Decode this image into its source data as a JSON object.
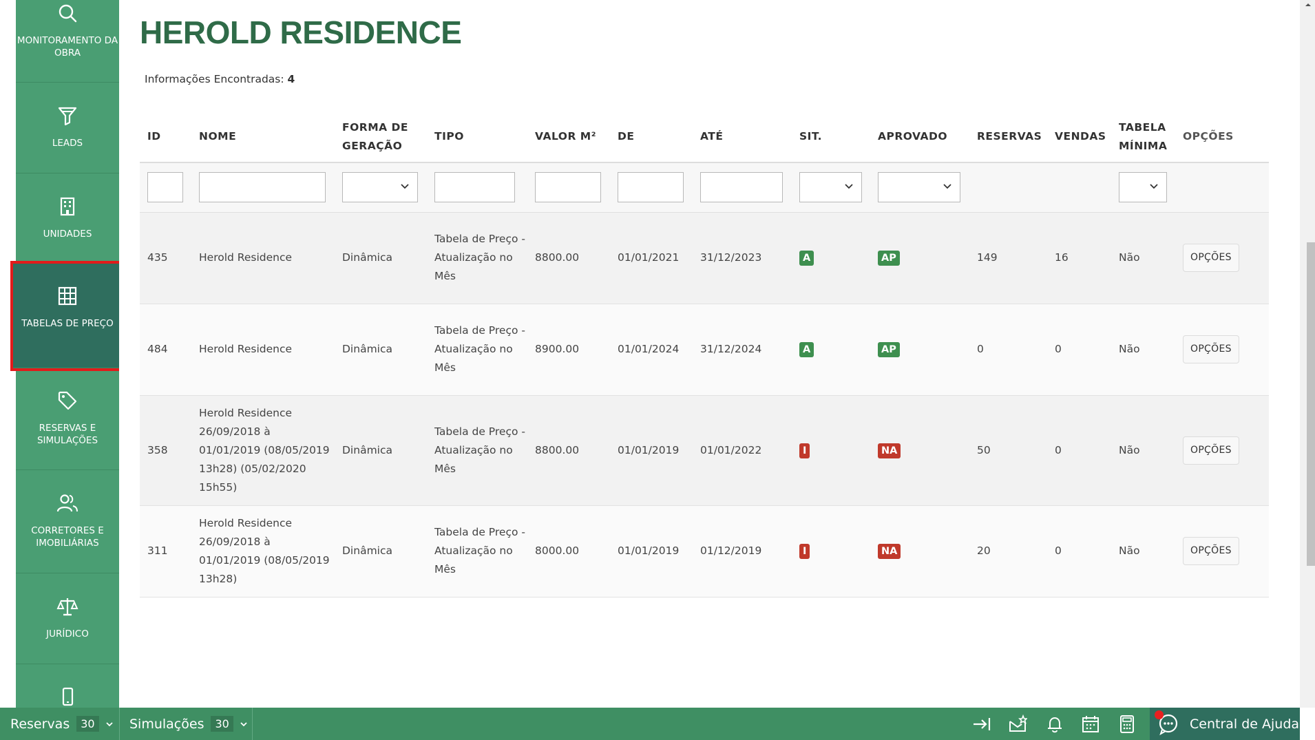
{
  "sidebar": {
    "items": [
      {
        "label": "MONITORAMENTO DA OBRA",
        "icon": "search-icon"
      },
      {
        "label": "LEADS",
        "icon": "filter-icon"
      },
      {
        "label": "UNIDADES",
        "icon": "building-icon"
      },
      {
        "label": "TABELAS DE PREÇO",
        "icon": "grid-table-icon",
        "active": true
      },
      {
        "label": "RESERVAS E SIMULAÇÕES",
        "icon": "tag-icon"
      },
      {
        "label": "CORRETORES E IMOBILIÁRIAS",
        "icon": "users-icon"
      },
      {
        "label": "JURÍDICO",
        "icon": "scales-icon"
      },
      {
        "label": "",
        "icon": "mobile-icon"
      }
    ]
  },
  "main": {
    "title": "HEROLD RESIDENCE",
    "info_label": "Informações Encontradas:",
    "info_count": "4"
  },
  "table": {
    "headers": [
      "ID",
      "NOME",
      "FORMA DE GERAÇÃO",
      "TIPO",
      "VALOR M²",
      "DE",
      "ATÉ",
      "SIT.",
      "APROVADO",
      "RESERVAS",
      "VENDAS",
      "TABELA MÍNIMA",
      "OPÇÕES"
    ],
    "rows": [
      {
        "id": "435",
        "nome": "Herold Residence",
        "forma": "Dinâmica",
        "tipo": "Tabela de Preço - Atualização no Mês",
        "valor": "8800.00",
        "de": "01/01/2021",
        "ate": "31/12/2023",
        "sit": "A",
        "aprovado": "AP",
        "reservas": "149",
        "vendas": "16",
        "tabela_minima": "Não",
        "opcoes": "OPÇÕES"
      },
      {
        "id": "484",
        "nome": "Herold Residence",
        "forma": "Dinâmica",
        "tipo": "Tabela de Preço - Atualização no Mês",
        "valor": "8900.00",
        "de": "01/01/2024",
        "ate": "31/12/2024",
        "sit": "A",
        "aprovado": "AP",
        "reservas": "0",
        "vendas": "0",
        "tabela_minima": "Não",
        "opcoes": "OPÇÕES"
      },
      {
        "id": "358",
        "nome": "Herold Residence 26/09/2018 à 01/01/2019 (08/05/2019 13h28) (05/02/2020 15h55)",
        "forma": "Dinâmica",
        "tipo": "Tabela de Preço - Atualização no Mês",
        "valor": "8800.00",
        "de": "01/01/2019",
        "ate": "01/01/2022",
        "sit": "I",
        "aprovado": "NA",
        "reservas": "50",
        "vendas": "0",
        "tabela_minima": "Não",
        "opcoes": "OPÇÕES"
      },
      {
        "id": "311",
        "nome": "Herold Residence 26/09/2018 à 01/01/2019 (08/05/2019 13h28)",
        "forma": "Dinâmica",
        "tipo": "Tabela de Preço - Atualização no Mês",
        "valor": "8000.00",
        "de": "01/01/2019",
        "ate": "01/12/2019",
        "sit": "I",
        "aprovado": "NA",
        "reservas": "20",
        "vendas": "0",
        "tabela_minima": "Não",
        "opcoes": "OPÇÕES"
      }
    ]
  },
  "bottombar": {
    "reservas_label": "Reservas",
    "reservas_count": "30",
    "simulacoes_label": "Simulações",
    "simulacoes_count": "30",
    "help_label": "Central de Ajuda"
  },
  "colors": {
    "sidebar_bg": "#4a9e73",
    "sidebar_active": "#2f6e5e",
    "title_green": "#2f6b48",
    "badge_green": "#3e8f4f",
    "badge_red": "#c0392b",
    "bottombar_bg": "#3f8f63"
  }
}
